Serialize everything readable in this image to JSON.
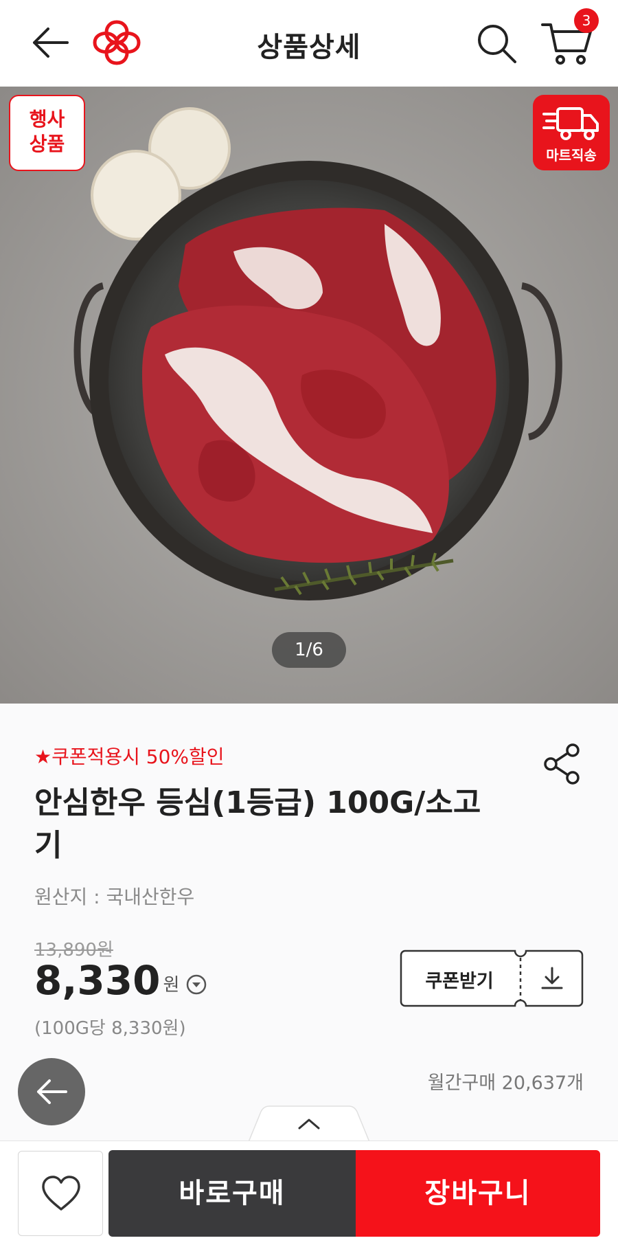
{
  "header": {
    "title": "상품상세",
    "cart_count": "3"
  },
  "hero": {
    "event_badge": "행사\n상품",
    "direct_delivery_label": "마트직송",
    "pager": "1/6"
  },
  "product": {
    "coupon_note": "★쿠폰적용시 50%할인",
    "name": "안심한우 등심(1등급) 100G/소고기",
    "origin": "원산지 : 국내산한우",
    "original_price": "13,890원",
    "price": "8,330",
    "price_unit": "원",
    "unit_price": "(100G당 8,330원)",
    "coupon_button_label": "쿠폰받기",
    "monthly_purchases": "월간구매 20,637개"
  },
  "bottom_bar": {
    "buy_now_label": "바로구매",
    "add_to_cart_label": "장바구니"
  },
  "colors": {
    "brand_red": "#e8141c",
    "dark_button": "#3a3a3c"
  },
  "icons": [
    "back-arrow-icon",
    "brand-logo-icon",
    "search-icon",
    "cart-icon",
    "truck-icon",
    "share-icon",
    "chevron-down-circle-icon",
    "download-icon",
    "heart-icon",
    "chevron-up-icon"
  ]
}
